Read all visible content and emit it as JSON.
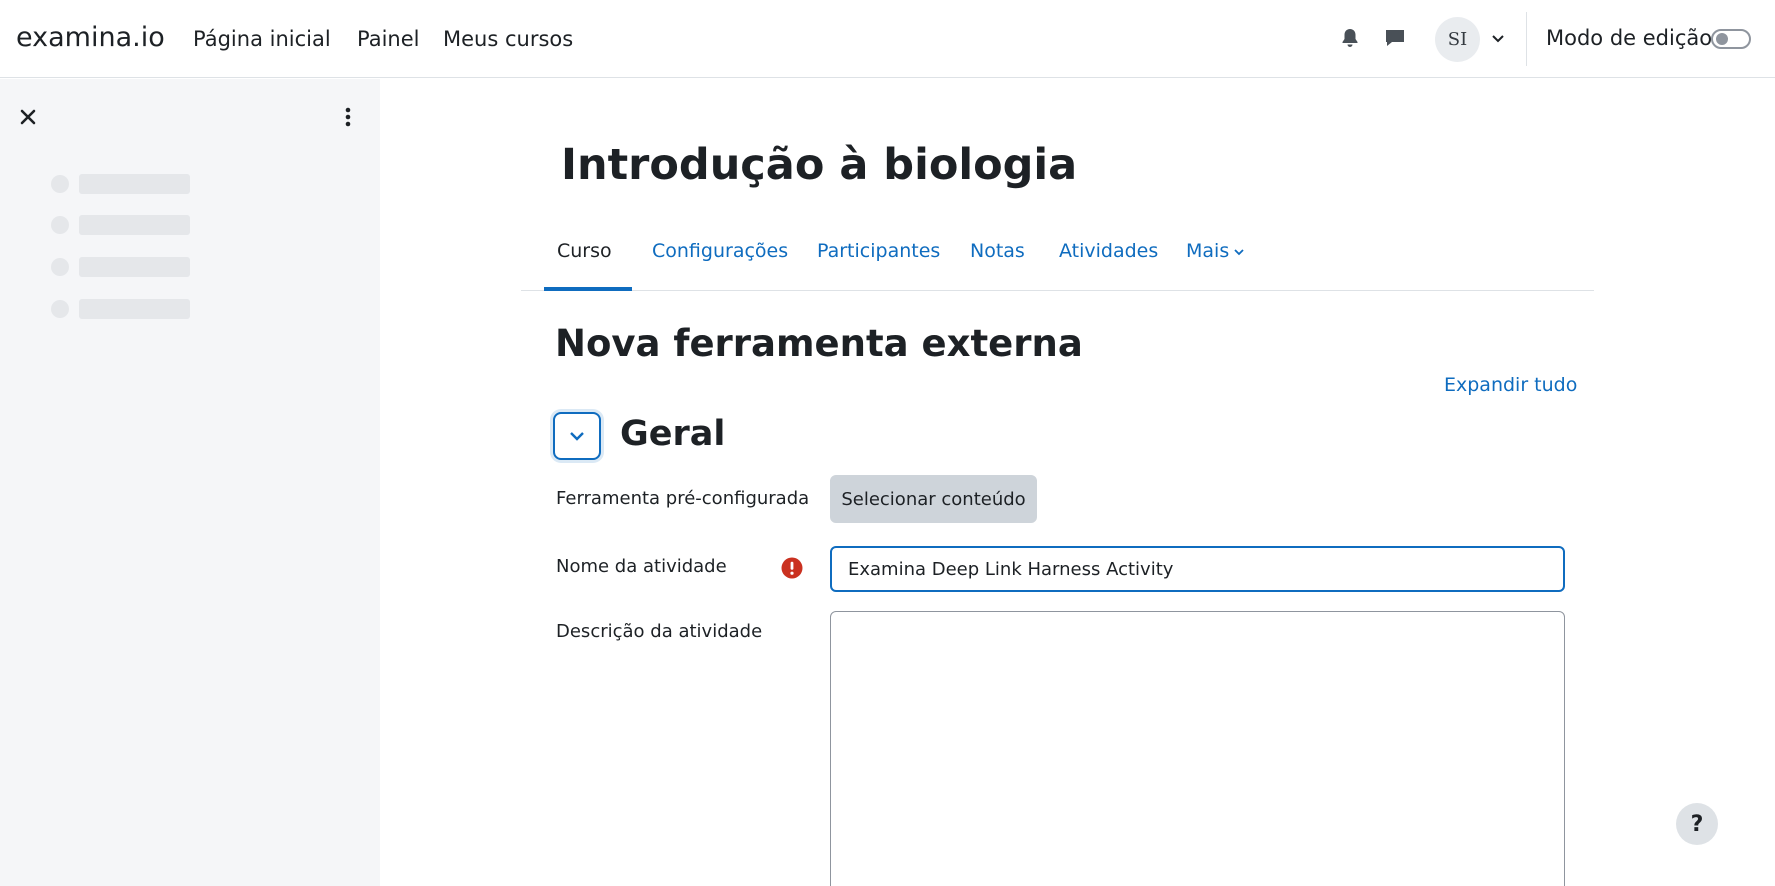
{
  "navbar": {
    "brand": "examina.io",
    "links": [
      "Página inicial",
      "Painel",
      "Meus cursos"
    ],
    "avatar_initials": "SI",
    "edit_mode_label": "Modo de edição",
    "edit_mode_on": false,
    "icons": [
      "bell-icon",
      "chat-icon",
      "chevron-down-icon"
    ]
  },
  "drawer": {
    "icons": [
      "close-icon",
      "kebab-menu-icon"
    ],
    "skeleton_rows": 4
  },
  "course": {
    "title": "Introdução à biologia"
  },
  "tabs": [
    {
      "label": "Curso",
      "active": true
    },
    {
      "label": "Configurações",
      "active": false
    },
    {
      "label": "Participantes",
      "active": false
    },
    {
      "label": "Notas",
      "active": false
    },
    {
      "label": "Atividades",
      "active": false
    },
    {
      "label": "Mais",
      "active": false
    }
  ],
  "page": {
    "heading": "Nova ferramenta externa",
    "expand_all": "Expandir tudo"
  },
  "section": {
    "title": "Geral"
  },
  "form": {
    "preconfigured_label": "Ferramenta pré-configurada",
    "select_content_button": "Selecionar conteúdo",
    "activity_name_label": "Nome da atividade",
    "activity_name_value": "Examina Deep Link Harness Activity",
    "activity_description_label": "Descrição da atividade",
    "activity_description_value": ""
  },
  "help": {
    "label": "?"
  },
  "colors": {
    "accent": "#0f6cbf",
    "required": "#ca3120",
    "drawer_bg": "#f5f6f8"
  }
}
